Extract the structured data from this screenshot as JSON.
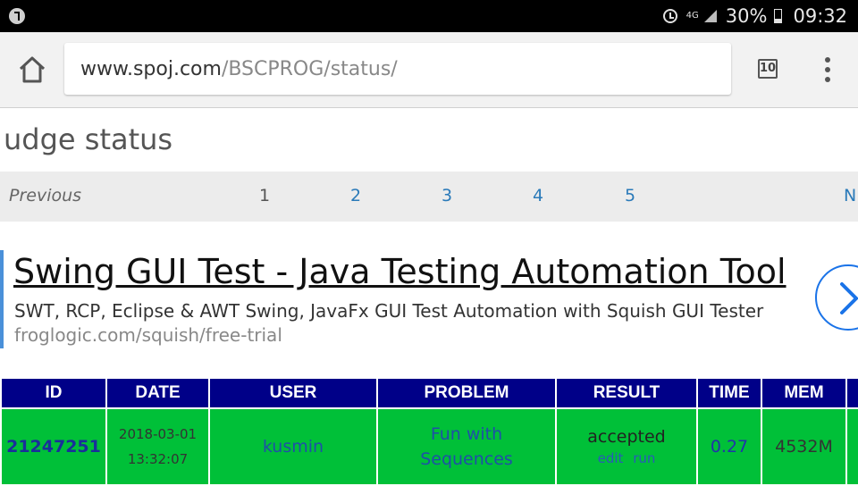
{
  "status_bar": {
    "network": "4G",
    "battery_percent": "30%",
    "time": "09:32"
  },
  "browser": {
    "url_domain": "www.spoj.com",
    "url_path": "/BSCPROG/status/",
    "tab_count": "10"
  },
  "page": {
    "heading": "udge status"
  },
  "pager": {
    "previous_label": "Previous",
    "pages": [
      "1",
      "2",
      "3",
      "4",
      "5"
    ],
    "current_page": "1",
    "next_label": "N"
  },
  "ad": {
    "title": "Swing GUI Test - Java Testing Automation Tool",
    "description": "SWT, RCP, Eclipse & AWT Swing, JavaFx GUI Test Automation with Squish GUI Tester",
    "url": "froglogic.com/squish/free-trial"
  },
  "table": {
    "headers": {
      "id": "ID",
      "date": "DATE",
      "user": "USER",
      "problem": "PROBLEM",
      "result": "RESULT",
      "time": "TIME",
      "mem": "MEM"
    },
    "rows": [
      {
        "id": "21247251",
        "date": "2018-03-01",
        "time_of_day": "13:32:07",
        "user": "kusmin",
        "problem_line1": "Fun with",
        "problem_line2": "Sequences",
        "result": "accepted",
        "edit_label": "edit",
        "run_label": "run",
        "time": "0.27",
        "mem": "4532M"
      }
    ]
  },
  "colors": {
    "header_bg": "#000088",
    "accepted_row_bg": "#00c038",
    "link_blue": "#2a7ab9"
  }
}
